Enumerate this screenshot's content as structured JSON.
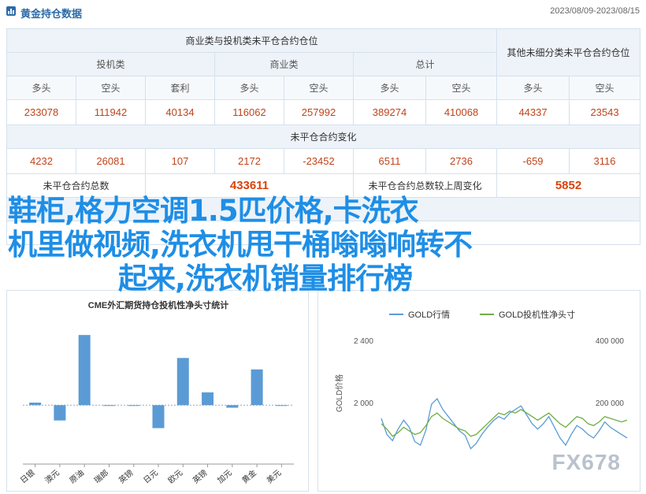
{
  "header": {
    "title": "黄金持仓数据",
    "date_range": "2023/08/09-2023/08/15"
  },
  "table": {
    "commercial_header": "商业类与投机类未平仓合约仓位",
    "other_header": "其他未细分类未平仓合约仓位",
    "groups": {
      "spec": "投机类",
      "comm": "商业类",
      "total": "总计"
    },
    "cols": [
      "多头",
      "空头",
      "套利",
      "多头",
      "空头",
      "多头",
      "空头",
      "多头",
      "空头"
    ],
    "positions": [
      "233078",
      "111942",
      "40134",
      "116062",
      "257992",
      "389274",
      "410068",
      "44337",
      "23543"
    ],
    "change_header": "未平仓合约变化",
    "changes": [
      "4232",
      "26081",
      "107",
      "2172",
      "-23452",
      "6511",
      "2736",
      "-659",
      "3116"
    ],
    "total_label": "未平仓合约总数",
    "total_value": "433611",
    "change_label": "未平仓合约总数较上周变化",
    "change_value": "5852"
  },
  "overlay_text": {
    "line1": "鞋柜,格力空调1.5匹价格,卡洗衣",
    "line2": "机里做视频,洗衣机甩干桶嗡嗡响转不",
    "line3": "起来,洗衣机销量排行榜"
  },
  "chart_data": [
    {
      "type": "bar",
      "title": "CME外汇期货持仓投机性净头寸统计",
      "categories": [
        "日银",
        "澳元",
        "原油",
        "瑞郎",
        "英镑",
        "日元",
        "欧元",
        "英镑",
        "加元",
        "黄金",
        "美元"
      ],
      "values": [
        2,
        -12,
        55,
        0,
        0,
        -18,
        37,
        10,
        -2,
        28,
        0
      ],
      "ylim": [
        -40,
        65
      ],
      "colors": {
        "bar": "#5b9bd5"
      }
    },
    {
      "type": "line",
      "legend": [
        "GOLD行情",
        "GOLD投机性净头寸"
      ],
      "ylabel_left": "GOLD价格",
      "left_ticks": [
        "2 400",
        "2 000"
      ],
      "right_ticks": [
        "400 000",
        "200 000"
      ],
      "series": [
        {
          "name": "GOLD行情",
          "color": "#5b9bd5",
          "values": [
            2050,
            1960,
            1925,
            1990,
            2040,
            2000,
            1920,
            1900,
            1985,
            2130,
            2160,
            2100,
            2060,
            2020,
            1980,
            1955,
            1880,
            1910,
            1960,
            2000,
            2035,
            2060,
            2045,
            2080,
            2100,
            2120,
            2070,
            2020,
            1990,
            2020,
            2060,
            2000,
            1940,
            1900,
            1960,
            2010,
            1990,
            1960,
            1940,
            1980,
            2030,
            2000,
            1980,
            1960,
            1940
          ]
        },
        {
          "name": "GOLD投机性净头寸",
          "color": "#70ad47",
          "values": [
            2020,
            1990,
            1950,
            1970,
            2000,
            1980,
            1960,
            1970,
            2010,
            2060,
            2080,
            2050,
            2030,
            2010,
            1990,
            1980,
            1950,
            1960,
            1990,
            2020,
            2050,
            2080,
            2070,
            2090,
            2080,
            2100,
            2080,
            2060,
            2040,
            2060,
            2080,
            2050,
            2020,
            2000,
            2030,
            2060,
            2050,
            2020,
            2010,
            2030,
            2060,
            2050,
            2040,
            2030,
            2040
          ]
        }
      ],
      "ylim": [
        1750,
        2500
      ]
    }
  ],
  "watermark": "FX678"
}
